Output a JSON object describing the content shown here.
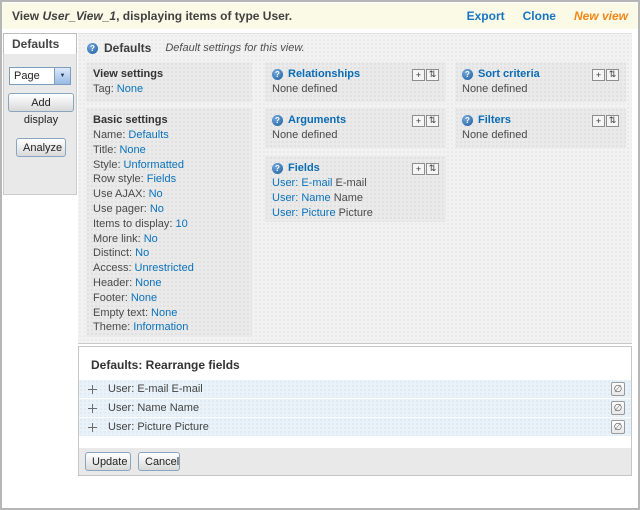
{
  "header": {
    "title_prefix": "View",
    "view_name": "User_View_1",
    "title_suffix": ", displaying items of type User.",
    "export": "Export",
    "clone": "Clone",
    "new_view": "New view"
  },
  "sidebar": {
    "tab": "Defaults",
    "display_type": "Page",
    "add_display": "Add display",
    "analyze": "Analyze"
  },
  "main": {
    "heading": "Defaults",
    "description": "Default settings for this view.",
    "view_settings": {
      "title": "View settings",
      "tag_label": "Tag:",
      "tag_value": "None"
    },
    "basic_settings": {
      "title": "Basic settings",
      "items": [
        {
          "label": "Name:",
          "value": "Defaults"
        },
        {
          "label": "Title:",
          "value": "None"
        },
        {
          "label": "Style:",
          "value": "Unformatted"
        },
        {
          "label": "Row style:",
          "value": "Fields"
        },
        {
          "label": "Use AJAX:",
          "value": "No"
        },
        {
          "label": "Use pager:",
          "value": "No"
        },
        {
          "label": "Items to display:",
          "value": "10"
        },
        {
          "label": "More link:",
          "value": "No"
        },
        {
          "label": "Distinct:",
          "value": "No"
        },
        {
          "label": "Access:",
          "value": "Unrestricted"
        },
        {
          "label": "Header:",
          "value": "None"
        },
        {
          "label": "Footer:",
          "value": "None"
        },
        {
          "label": "Empty text:",
          "value": "None"
        },
        {
          "label": "Theme:",
          "value": "Information"
        }
      ]
    },
    "relationships": {
      "title": "Relationships",
      "body": "None defined"
    },
    "arguments": {
      "title": "Arguments",
      "body": "None defined"
    },
    "sort_criteria": {
      "title": "Sort criteria",
      "body": "None defined"
    },
    "filters": {
      "title": "Filters",
      "body": "None defined"
    },
    "fields": {
      "title": "Fields",
      "items": [
        {
          "link": "User: E-mail",
          "text": "E-mail"
        },
        {
          "link": "User: Name",
          "text": "Name"
        },
        {
          "link": "User: Picture",
          "text": "Picture"
        }
      ]
    }
  },
  "rearrange": {
    "title": "Defaults: Rearrange fields",
    "rows": [
      {
        "label": "User: E-mail E-mail"
      },
      {
        "label": "User: Name Name"
      },
      {
        "label": "User: Picture Picture"
      }
    ],
    "update": "Update",
    "cancel": "Cancel"
  },
  "icons": {
    "help": "?",
    "plus": "+",
    "updown": "⇅",
    "remove": "∅",
    "select_arrow": "▼"
  },
  "colors": {
    "link_blue": "#0a72bb",
    "heading_blue": "#0a6cb4",
    "new_view_orange": "#f28718",
    "topbar_bg": "#fbfae7",
    "row_bg": "#e9f2f8"
  }
}
